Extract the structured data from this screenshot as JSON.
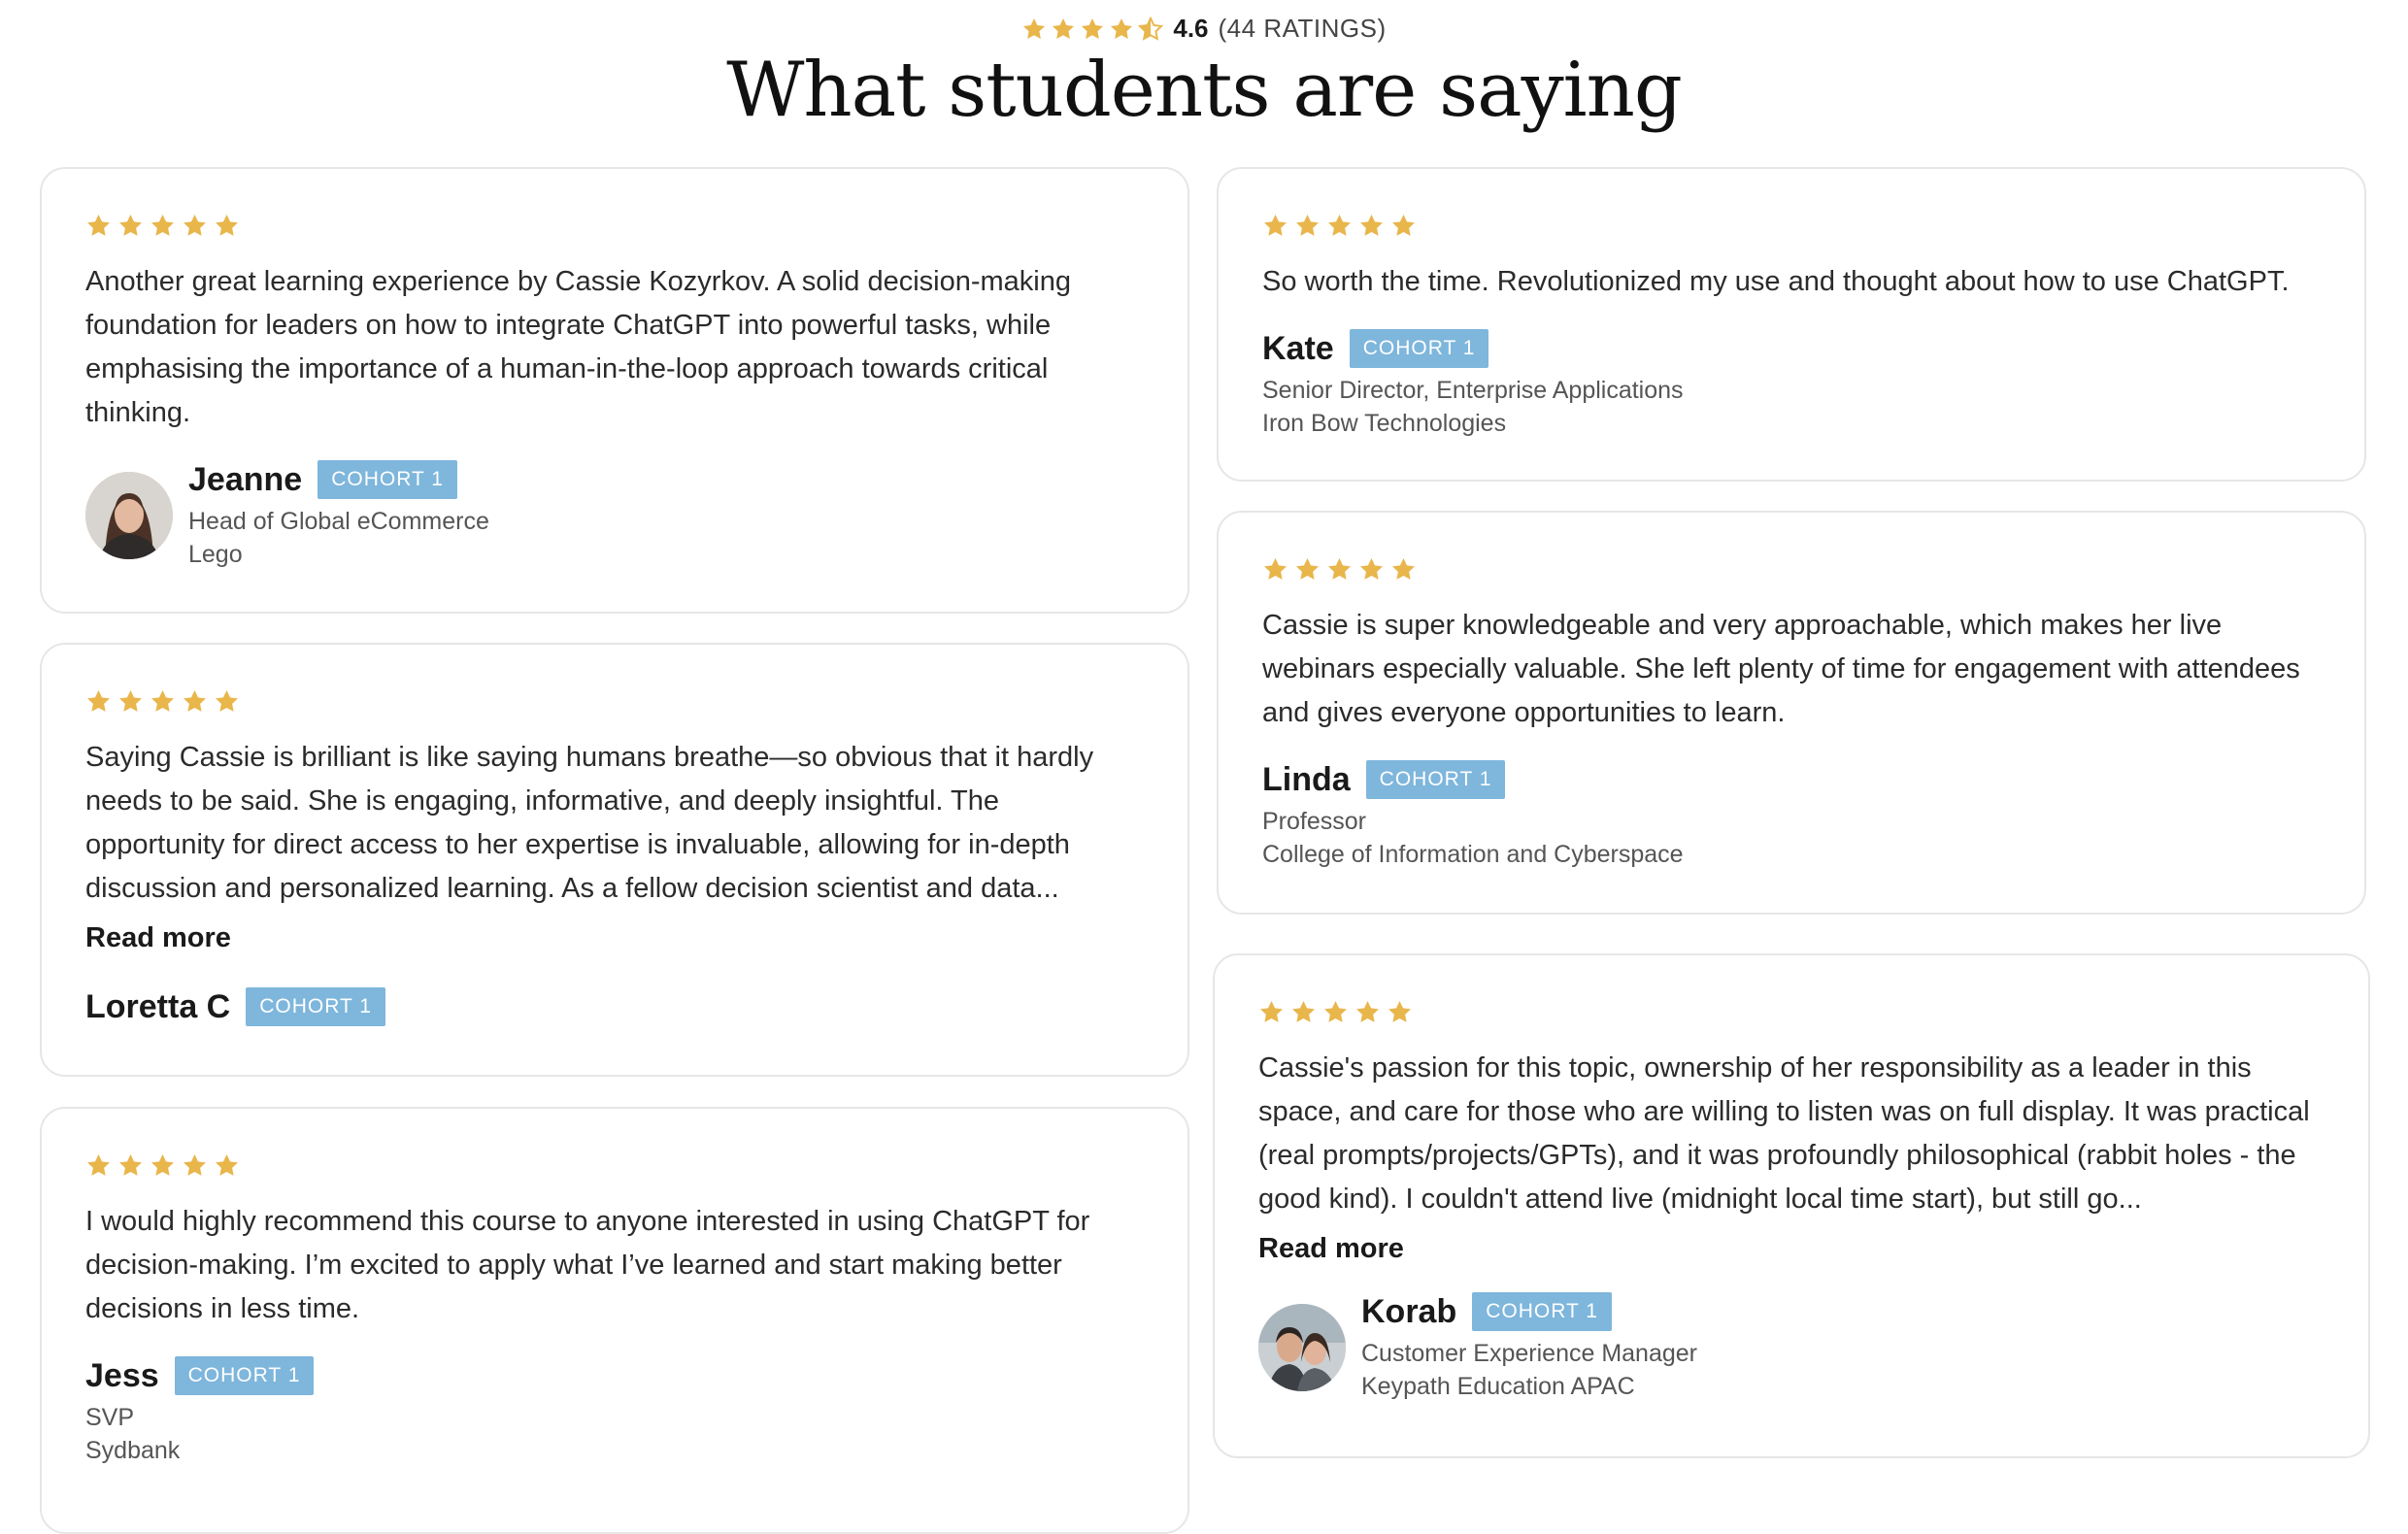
{
  "summary": {
    "average": "4.6",
    "count_text": "(44 RATINGS)",
    "stars_full": 4,
    "stars_partial": 0.6,
    "star_color": "#e8b64b"
  },
  "heading": "What students are saying",
  "badge_color": "#7eb6dc",
  "reviews": [
    {
      "stars": 5,
      "text": "Another great learning experience by Cassie Kozyrkov. A solid decision-making foundation for leaders on how to integrate ChatGPT into powerful tasks, while emphasising the importance of a human-in-the-loop approach towards critical thinking.",
      "name": "Jeanne",
      "badge": "COHORT 1",
      "title": "Head of Global eCommerce",
      "company": "Lego",
      "avatar": "woman-portrait"
    },
    {
      "stars": 5,
      "text": "Saying Cassie is brilliant is like saying humans breathe—so obvious that it hardly needs to be said. She is engaging, informative, and deeply insightful. The opportunity for direct access to her expertise is invaluable, allowing for in-depth discussion and personalized learning. As a fellow decision scientist and data...",
      "read_more": "Read more",
      "name": "Loretta C",
      "badge": "COHORT 1"
    },
    {
      "stars": 5,
      "text": "I would highly recommend this course to anyone interested in using ChatGPT for decision-making. I’m excited to apply what I’ve learned and start making better decisions in less time.",
      "name": "Jess",
      "badge": "COHORT 1",
      "title": "SVP",
      "company": "Sydbank"
    },
    {
      "stars": 5,
      "text": "So worth the time. Revolutionized my use and thought about how to use ChatGPT.",
      "name": "Kate",
      "badge": "COHORT 1",
      "title": "Senior Director, Enterprise Applications",
      "company": "Iron Bow Technologies"
    },
    {
      "stars": 5,
      "text": "Cassie is super knowledgeable and very approachable, which makes her live webinars especially valuable. She left plenty of time for engagement with attendees and gives everyone opportunities to learn.",
      "name": "Linda",
      "badge": "COHORT 1",
      "title": "Professor",
      "company": "College of Information and Cyberspace"
    },
    {
      "stars": 5,
      "text": "Cassie's passion for this topic, ownership of her responsibility as a leader in this space, and care for those who are willing to listen was on full display. It was practical (real prompts/projects/GPTs), and it was profoundly philosophical (rabbit holes - the good kind). I couldn't attend live (midnight local time start), but still go...",
      "read_more": "Read more",
      "name": "Korab",
      "badge": "COHORT 1",
      "title": "Customer Experience Manager",
      "company": "Keypath Education APAC",
      "avatar": "couple-photo"
    }
  ]
}
